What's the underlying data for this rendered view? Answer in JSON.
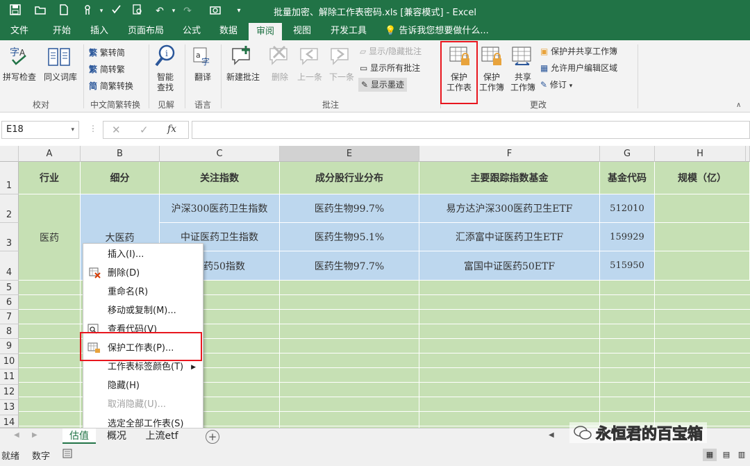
{
  "title": "批量加密、解除工作表密码.xls [兼容模式] - Excel",
  "quick_access": {
    "undo": "↶",
    "redo": "↷",
    "more": "▾"
  },
  "tabs": [
    "文件",
    "开始",
    "插入",
    "页面布局",
    "公式",
    "数据",
    "审阅",
    "视图",
    "开发工具"
  ],
  "tell_me": "告诉我您想要做什么...",
  "ribbon": {
    "spell": "拼写检查",
    "thesaurus": "同义词库",
    "grp_proofing": "校对",
    "trad_to_simp": "繁转简",
    "simp_to_trad": "简转繁",
    "convert": "简繁转换",
    "grp_chinese": "中文简繁转换",
    "smart_lookup_1": "智能",
    "smart_lookup_2": "查找",
    "grp_insights": "见解",
    "translate": "翻译",
    "grp_language": "语言",
    "new_comment": "新建批注",
    "delete": "删除",
    "prev": "上一条",
    "next": "下一条",
    "show_hide_comment": "显示/隐藏批注",
    "show_all_comments": "显示所有批注",
    "show_ink": "显示墨迹",
    "grp_comments": "批注",
    "protect_sheet_1": "保护",
    "protect_sheet_2": "工作表",
    "protect_wb_1": "保护",
    "protect_wb_2": "工作簿",
    "share_wb_1": "共享",
    "share_wb_2": "工作簿",
    "protect_share": "保护并共享工作簿",
    "allow_edit": "允许用户编辑区域",
    "track": "修订",
    "grp_changes": "更改"
  },
  "formula": {
    "namebox": "E18",
    "fx": "fx",
    "cancel": "✕",
    "confirm": "✓"
  },
  "columns": [
    "A",
    "B",
    "C",
    "E",
    "F",
    "G",
    "H"
  ],
  "rows": [
    "1",
    "2",
    "3",
    "4",
    "5",
    "6",
    "7",
    "8",
    "9",
    "10",
    "11",
    "12",
    "13",
    "14"
  ],
  "headers": [
    "行业",
    "细分",
    "关注指数",
    "成分股行业分布",
    "主要跟踪指数基金",
    "基金代码",
    "规模（亿）"
  ],
  "industry": "医药",
  "sub": "大医药",
  "data_rows": [
    {
      "index": "沪深300医药卫生指数",
      "dist": "医药生物99.7%",
      "fund": "易方达沪深300医药卫生ETF",
      "code": "512010"
    },
    {
      "index": "中证医药卫生指数",
      "dist": "医药生物95.1%",
      "fund": "汇添富中证医药卫生ETF",
      "code": "159929"
    },
    {
      "index": "医药50指数",
      "dist": "医药生物97.7%",
      "fund": "富国中证医药50ETF",
      "code": "515950"
    }
  ],
  "menu": [
    {
      "label": "插入(I)...",
      "dis": false
    },
    {
      "label": "删除(D)",
      "dis": false
    },
    {
      "label": "重命名(R)",
      "dis": false
    },
    {
      "label": "移动或复制(M)...",
      "dis": false
    },
    {
      "label": "查看代码(V)",
      "dis": false
    },
    {
      "label": "保护工作表(P)...",
      "dis": false
    },
    {
      "label": "工作表标签颜色(T)",
      "dis": false
    },
    {
      "label": "隐藏(H)",
      "dis": false
    },
    {
      "label": "取消隐藏(U)...",
      "dis": true
    },
    {
      "label": "选定全部工作表(S)",
      "dis": false
    }
  ],
  "sheets": [
    "估值",
    "概况",
    "上流etf"
  ],
  "status": {
    "ready": "就绪",
    "num": "数字"
  },
  "watermark": "永恒君的百宝箱",
  "colors": {
    "green": "#217346",
    "red": "#e8161e",
    "cell_green": "#c6e0b4",
    "cell_blue": "#bdd7ee"
  }
}
